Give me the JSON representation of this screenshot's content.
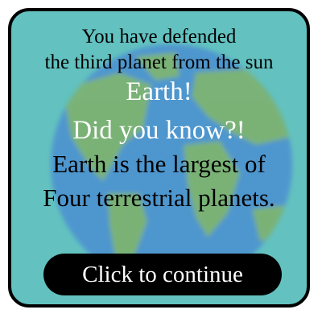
{
  "dialog": {
    "line1": "You have defended",
    "line2": "the third planet from the sun",
    "planet_name": "Earth!",
    "did_you_know": "Did you know?!",
    "fact_line1": "Earth is the largest of",
    "fact_line2": "Four terrestrial planets.",
    "continue_label": "Click to continue"
  },
  "background_image": {
    "icon": "earth-globe-pixel-art",
    "ocean_color": "#4b8fd1",
    "land_color": "#7fb06a",
    "panel_color": "#63c2c0"
  }
}
